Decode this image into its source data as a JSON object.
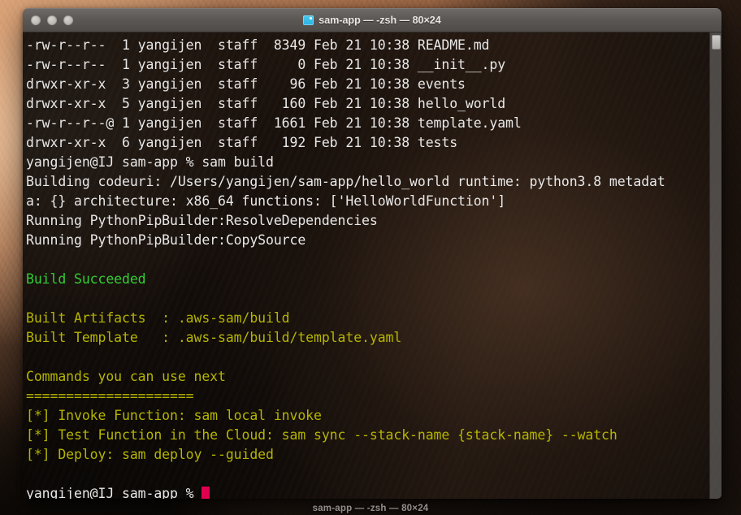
{
  "desktop": {
    "wallpaper_name": "el-capitan-sunset"
  },
  "window": {
    "title": "sam-app — -zsh — 80×24",
    "icon": "terminal-folder-icon",
    "traffic_lights": [
      {
        "name": "close-button",
        "color": "#c9c6c2"
      },
      {
        "name": "minimize-button",
        "color": "#c9c6c2"
      },
      {
        "name": "zoom-button",
        "color": "#c9c6c2"
      }
    ],
    "bottom_label": "sam-app — -zsh — 80×24"
  },
  "colors": {
    "foreground": "#e8e8e8",
    "green": "#33cc33",
    "yellow": "#b5b500",
    "cursor": "#e0004f",
    "background": "rgba(0,0,0,0.74)"
  },
  "terminal": {
    "prompt": "yangijen@IJ sam-app % ",
    "command": "sam build",
    "final_prompt": "yangijen@IJ sam-app % ",
    "lines": [
      {
        "text": "-rw-r--r--  1 yangijen  staff  8349 Feb 21 10:38 README.md",
        "color": "white"
      },
      {
        "text": "-rw-r--r--  1 yangijen  staff     0 Feb 21 10:38 __init__.py",
        "color": "white"
      },
      {
        "text": "drwxr-xr-x  3 yangijen  staff    96 Feb 21 10:38 events",
        "color": "white"
      },
      {
        "text": "drwxr-xr-x  5 yangijen  staff   160 Feb 21 10:38 hello_world",
        "color": "white"
      },
      {
        "text": "-rw-r--r--@ 1 yangijen  staff  1661 Feb 21 10:38 template.yaml",
        "color": "white"
      },
      {
        "text": "drwxr-xr-x  6 yangijen  staff   192 Feb 21 10:38 tests",
        "color": "white"
      },
      {
        "text": "yangijen@IJ sam-app % sam build",
        "color": "white"
      },
      {
        "text": "Building codeuri: /Users/yangijen/sam-app/hello_world runtime: python3.8 metadat",
        "color": "white"
      },
      {
        "text": "a: {} architecture: x86_64 functions: ['HelloWorldFunction']",
        "color": "white"
      },
      {
        "text": "Running PythonPipBuilder:ResolveDependencies",
        "color": "white"
      },
      {
        "text": "Running PythonPipBuilder:CopySource",
        "color": "white"
      },
      {
        "text": "",
        "color": "white"
      },
      {
        "text": "Build Succeeded",
        "color": "green"
      },
      {
        "text": "",
        "color": "white"
      },
      {
        "text": "Built Artifacts  : .aws-sam/build",
        "color": "yellow"
      },
      {
        "text": "Built Template   : .aws-sam/build/template.yaml",
        "color": "yellow"
      },
      {
        "text": "",
        "color": "white"
      },
      {
        "text": "Commands you can use next",
        "color": "yellow"
      },
      {
        "text": "=====================",
        "color": "yellow"
      },
      {
        "text": "[*] Invoke Function: sam local invoke",
        "color": "yellow"
      },
      {
        "text": "[*] Test Function in the Cloud: sam sync --stack-name {stack-name} --watch",
        "color": "yellow"
      },
      {
        "text": "[*] Deploy: sam deploy --guided",
        "color": "yellow"
      },
      {
        "text": "",
        "color": "white"
      },
      {
        "text": "yangijen@IJ sam-app % ",
        "color": "white",
        "cursor": true
      }
    ]
  }
}
